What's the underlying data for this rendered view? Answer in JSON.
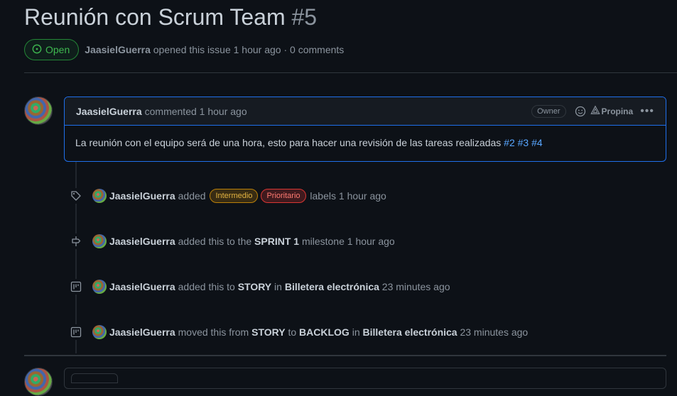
{
  "issue": {
    "title": "Reunión con Scrum Team",
    "number": "#5",
    "state": "Open",
    "author": "JaasielGuerra",
    "opened_text": "opened this issue",
    "opened_time": "1 hour ago",
    "separator": "·",
    "comments_count": "0 comments"
  },
  "comment": {
    "author": "JaasielGuerra",
    "action": "commented",
    "time": "1 hour ago",
    "owner_badge": "Owner",
    "propina_label": "Propina",
    "body_text": "La reunión con el equipo será de una hora, esto para hacer una revisión de las tareas realizadas",
    "refs": [
      "#2",
      "#3",
      "#4"
    ],
    "icons": {
      "emoji": "smiley-icon",
      "propina": "propina-icon",
      "more": "kebab-icon"
    }
  },
  "events": [
    {
      "icon": "tag-icon",
      "actor": "JaasielGuerra",
      "text_before": "added",
      "labels": [
        {
          "name": "Intermedio",
          "color": "#bb8009"
        },
        {
          "name": "Prioritario",
          "color": "#da3633"
        }
      ],
      "text_after": "labels",
      "time": "1 hour ago"
    },
    {
      "icon": "milestone-icon",
      "actor": "JaasielGuerra",
      "text_before": "added this to the",
      "milestone": "SPRINT 1",
      "text_after": "milestone",
      "time": "1 hour ago"
    },
    {
      "icon": "project-icon",
      "actor": "JaasielGuerra",
      "text_before": "added this to",
      "column": "STORY",
      "in_text": "in",
      "project": "Billetera electrónica",
      "time": "23 minutes ago"
    },
    {
      "icon": "project-icon",
      "actor": "JaasielGuerra",
      "text_before": "moved this from",
      "from_column": "STORY",
      "to_text": "to",
      "to_column": "BACKLOG",
      "in_text": "in",
      "project": "Billetera electrónica",
      "time": "23 minutes ago"
    }
  ],
  "colors": {
    "background": "#0d1117",
    "open_green": "#3fb950",
    "link_blue": "#58a6ff",
    "border_blue": "#1f6feb"
  }
}
